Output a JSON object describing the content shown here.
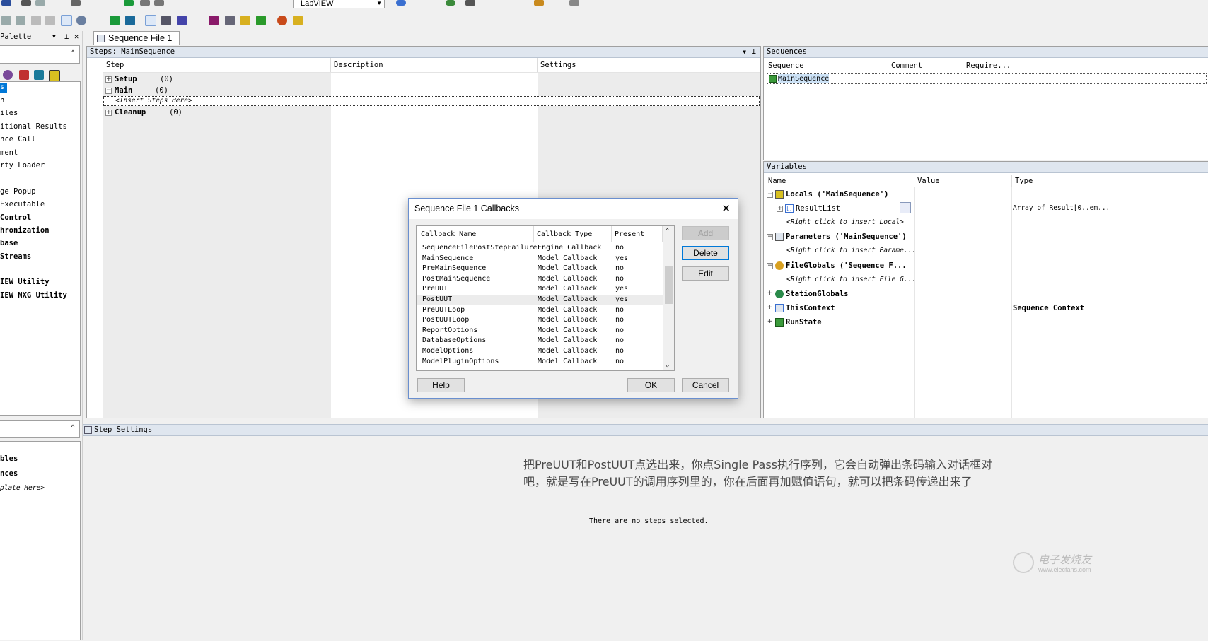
{
  "toolbar": {
    "adapter_value": "LabVIEW"
  },
  "left_palette": {
    "title": "Palette",
    "items": [
      "s",
      "n",
      "iles",
      "itional Results",
      "nce Call",
      "ment",
      "rty Loader",
      "",
      "ge Popup",
      "Executable",
      " Control",
      "hronization",
      "base",
      " Streams",
      "",
      "IEW Utility",
      "IEW NXG Utility"
    ],
    "bottom_items": [
      "bles",
      "nces",
      "plate Here>"
    ]
  },
  "document_tab": {
    "label": "Sequence File 1"
  },
  "steps_panel": {
    "title": "Steps: MainSequence",
    "columns": [
      "Step",
      "Description",
      "Settings"
    ],
    "groups": [
      {
        "label": "Setup",
        "count": "(0)"
      },
      {
        "label": "Main",
        "count": "(0)"
      },
      {
        "label": "Cleanup",
        "count": "(0)"
      }
    ],
    "insert_placeholder": "<Insert Steps Here>"
  },
  "sequences_panel": {
    "title": "Sequences",
    "columns": [
      "Sequence",
      "Comment",
      "Require..."
    ],
    "rows": [
      "MainSequence"
    ]
  },
  "variables_panel": {
    "title": "Variables",
    "columns": [
      "Name",
      "Value",
      "Type"
    ],
    "locals": "Locals ('MainSequence')",
    "result_list": "ResultList",
    "result_list_type": "Array of Result[0..em...",
    "insert_local": "<Right click to insert Local>",
    "parameters": "Parameters ('MainSequence')",
    "insert_param": "<Right click to insert Parame...",
    "file_globals": "FileGlobals ('Sequence F...",
    "insert_fileglobal": "<Right click to insert File G...",
    "station_globals": "StationGlobals",
    "this_context": "ThisContext",
    "this_context_type": "Sequence Context",
    "run_state": "RunState"
  },
  "step_settings": {
    "title": "Step Settings",
    "empty_text": "There are no steps selected."
  },
  "annotation": {
    "line1": "把PreUUT和PostUUT点选出来，你点Single Pass执行序列，它会自动弹出条码输入对话框对",
    "line2": "吧，就是写在PreUUT的调用序列里的，你在后面再加赋值语句，就可以把条码传递出来了"
  },
  "watermark": {
    "cn": "电子发烧友",
    "url": "www.elecfans.com"
  },
  "dialog": {
    "title": "Sequence File 1 Callbacks",
    "columns": [
      "Callback Name",
      "Callback Type",
      "Present"
    ],
    "rows": [
      {
        "name": "SequenceFilePostStepFailure",
        "type": "Engine Callback",
        "present": "no"
      },
      {
        "name": "MainSequence",
        "type": "Model Callback",
        "present": "yes"
      },
      {
        "name": "PreMainSequence",
        "type": "Model Callback",
        "present": "no"
      },
      {
        "name": "PostMainSequence",
        "type": "Model Callback",
        "present": "no"
      },
      {
        "name": "PreUUT",
        "type": "Model Callback",
        "present": "yes"
      },
      {
        "name": "PostUUT",
        "type": "Model Callback",
        "present": "yes"
      },
      {
        "name": "PreUUTLoop",
        "type": "Model Callback",
        "present": "no"
      },
      {
        "name": "PostUUTLoop",
        "type": "Model Callback",
        "present": "no"
      },
      {
        "name": "ReportOptions",
        "type": "Model Callback",
        "present": "no"
      },
      {
        "name": "DatabaseOptions",
        "type": "Model Callback",
        "present": "no"
      },
      {
        "name": "ModelOptions",
        "type": "Model Callback",
        "present": "no"
      },
      {
        "name": "ModelPluginOptions",
        "type": "Model Callback",
        "present": "no"
      }
    ],
    "buttons": {
      "add": "Add",
      "delete": "Delete",
      "edit": "Edit",
      "help": "Help",
      "ok": "OK",
      "cancel": "Cancel"
    }
  }
}
